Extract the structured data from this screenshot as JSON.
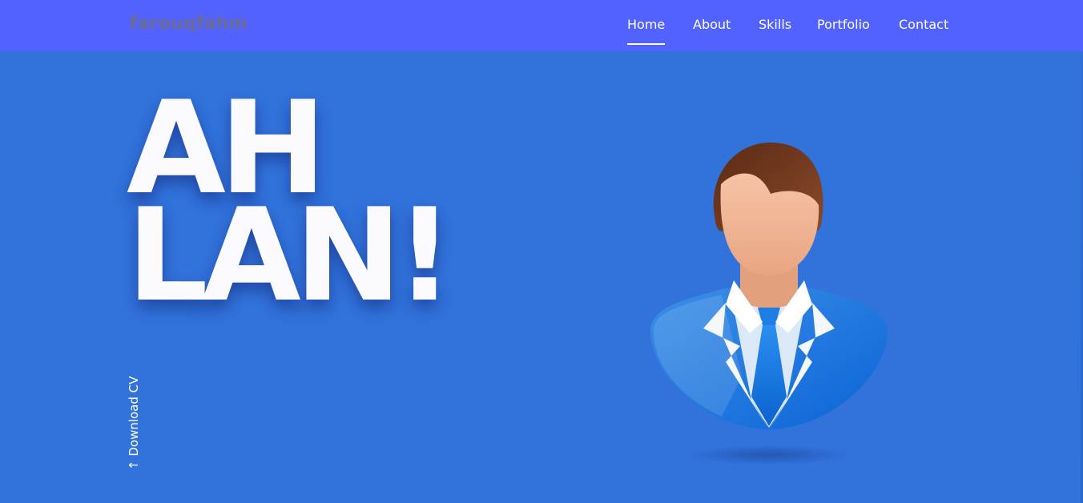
{
  "brand": {
    "name": "farouqfahm"
  },
  "nav": {
    "items": [
      {
        "label": "Home",
        "active": true
      },
      {
        "label": "About"
      },
      {
        "label": "Skills"
      },
      {
        "label": "Portfolio"
      },
      {
        "label": "Contact"
      }
    ]
  },
  "hero": {
    "line1": "AH",
    "line2": "LAN!",
    "download_label": "↑ Download CV",
    "avatar_icon": "businessman-avatar-icon"
  },
  "colors": {
    "background": "#3172db",
    "navbar": "#5262ff",
    "brand_text": "#6b6b93",
    "title_text": "#fbfbff"
  }
}
